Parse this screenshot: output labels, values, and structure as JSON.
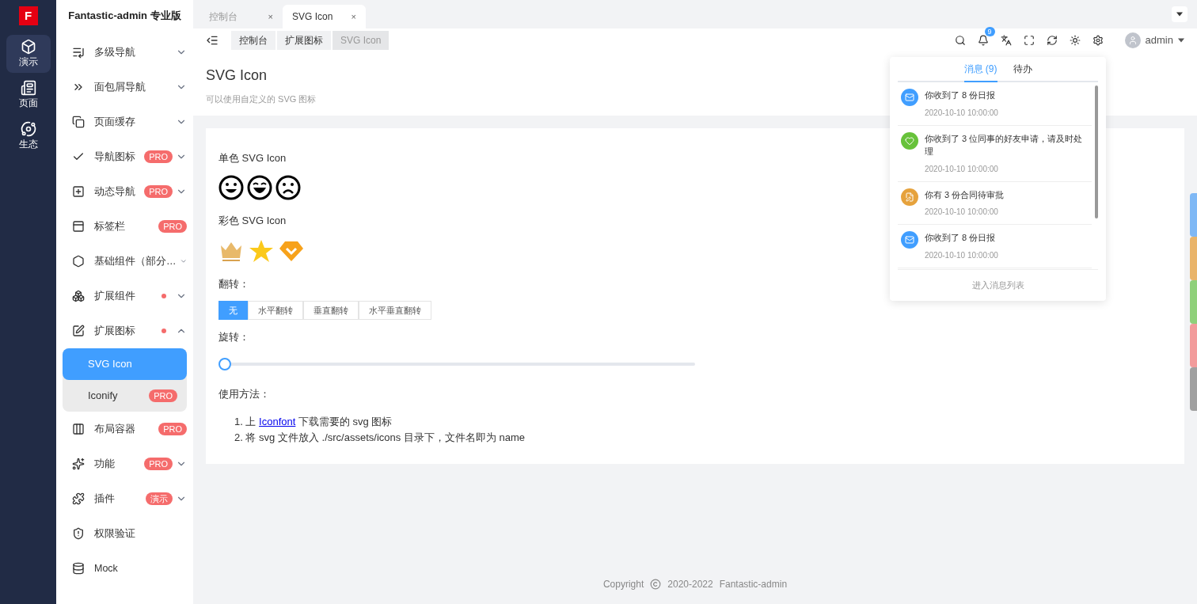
{
  "logo": {
    "text": "F"
  },
  "rail": [
    {
      "label": "演示",
      "selected": true
    },
    {
      "label": "页面",
      "selected": false
    },
    {
      "label": "生态",
      "selected": false
    }
  ],
  "app_title": "Fantastic-admin 专业版",
  "menu": [
    {
      "label": "多级导航",
      "expanded": false
    },
    {
      "label": "面包屑导航",
      "expanded": false
    },
    {
      "label": "页面缓存",
      "expanded": false
    },
    {
      "label": "导航图标",
      "badge": "PRO",
      "expanded": false
    },
    {
      "label": "动态导航",
      "badge": "PRO",
      "expanded": false
    },
    {
      "label": "标签栏",
      "badge": "PRO"
    },
    {
      "label": "基础组件（部分…",
      "expanded": false
    },
    {
      "label": "扩展组件",
      "dot": true,
      "expanded": false
    },
    {
      "label": "扩展图标",
      "dot": true,
      "expanded": true,
      "children": [
        {
          "label": "SVG Icon",
          "selected": true
        },
        {
          "label": "Iconify",
          "badge": "PRO",
          "selected": false
        }
      ]
    },
    {
      "label": "布局容器",
      "badge": "PRO"
    },
    {
      "label": "功能",
      "badge": "PRO",
      "expanded": false
    },
    {
      "label": "插件",
      "badge": "演示",
      "expanded": false
    },
    {
      "label": "权限验证"
    },
    {
      "label": "Mock"
    }
  ],
  "tabs": [
    {
      "label": "控制台",
      "close": "×",
      "selected": false
    },
    {
      "label": "SVG Icon",
      "close": "×",
      "selected": true
    }
  ],
  "breadcrumb": [
    {
      "label": "控制台",
      "current": false
    },
    {
      "label": "扩展图标",
      "current": false
    },
    {
      "label": "SVG Icon",
      "current": true
    }
  ],
  "toolbar": {
    "badge": "9",
    "user": "admin"
  },
  "page_header": {
    "title": "SVG Icon",
    "description": "可以使用自定义的 SVG 图标"
  },
  "content": {
    "mono_title": "单色 SVG Icon",
    "color_title": "彩色 SVG Icon",
    "flip_label": "翻转：",
    "flip_options": [
      {
        "label": "无",
        "selected": true
      },
      {
        "label": "水平翻转",
        "selected": false
      },
      {
        "label": "垂直翻转",
        "selected": false
      },
      {
        "label": "水平垂直翻转",
        "selected": false
      }
    ],
    "rotate_label": "旋转：",
    "rotate": {
      "level": 0
    },
    "usage_label": "使用方法：",
    "steps": [
      {
        "number": "1.",
        "before": "上 ",
        "link": "Iconfont",
        "after": " 下载需要的 svg 图标"
      },
      {
        "number": "2.",
        "before": "将 svg 文件放入 ./src/assets/icons 目录下，文件名即为 name"
      }
    ]
  },
  "footer": {
    "copyright": "Copyright",
    "years": "2020-2022",
    "name": "Fantastic-admin"
  },
  "notifications": {
    "tabs": [
      {
        "label": "消息 (9)",
        "selected": true
      },
      {
        "label": "待办",
        "selected": false
      }
    ],
    "items": [
      {
        "kind": "mail",
        "color": "#409eff",
        "text": "你收到了 8 份日报",
        "time": "2020-10-10 10:00:00"
      },
      {
        "kind": "friend",
        "color": "#67c23a",
        "text": "你收到了 3 位同事的好友申请，请及时处理",
        "time": "2020-10-10 10:00:00"
      },
      {
        "kind": "contract",
        "color": "#e6a23c",
        "text": "你有 3 份合同待审批",
        "time": "2020-10-10 10:00:00"
      },
      {
        "kind": "mail",
        "color": "#409eff",
        "text": "你收到了 8 份日报",
        "time": "2020-10-10 10:00:00"
      }
    ],
    "more": "进入消息列表"
  },
  "side_tabs": [
    {
      "color": "#7fb8f5"
    },
    {
      "color": "#e9b46a"
    },
    {
      "color": "#8fd07a"
    },
    {
      "color": "#f29b9b"
    },
    {
      "color": "#a0a0a0"
    }
  ]
}
